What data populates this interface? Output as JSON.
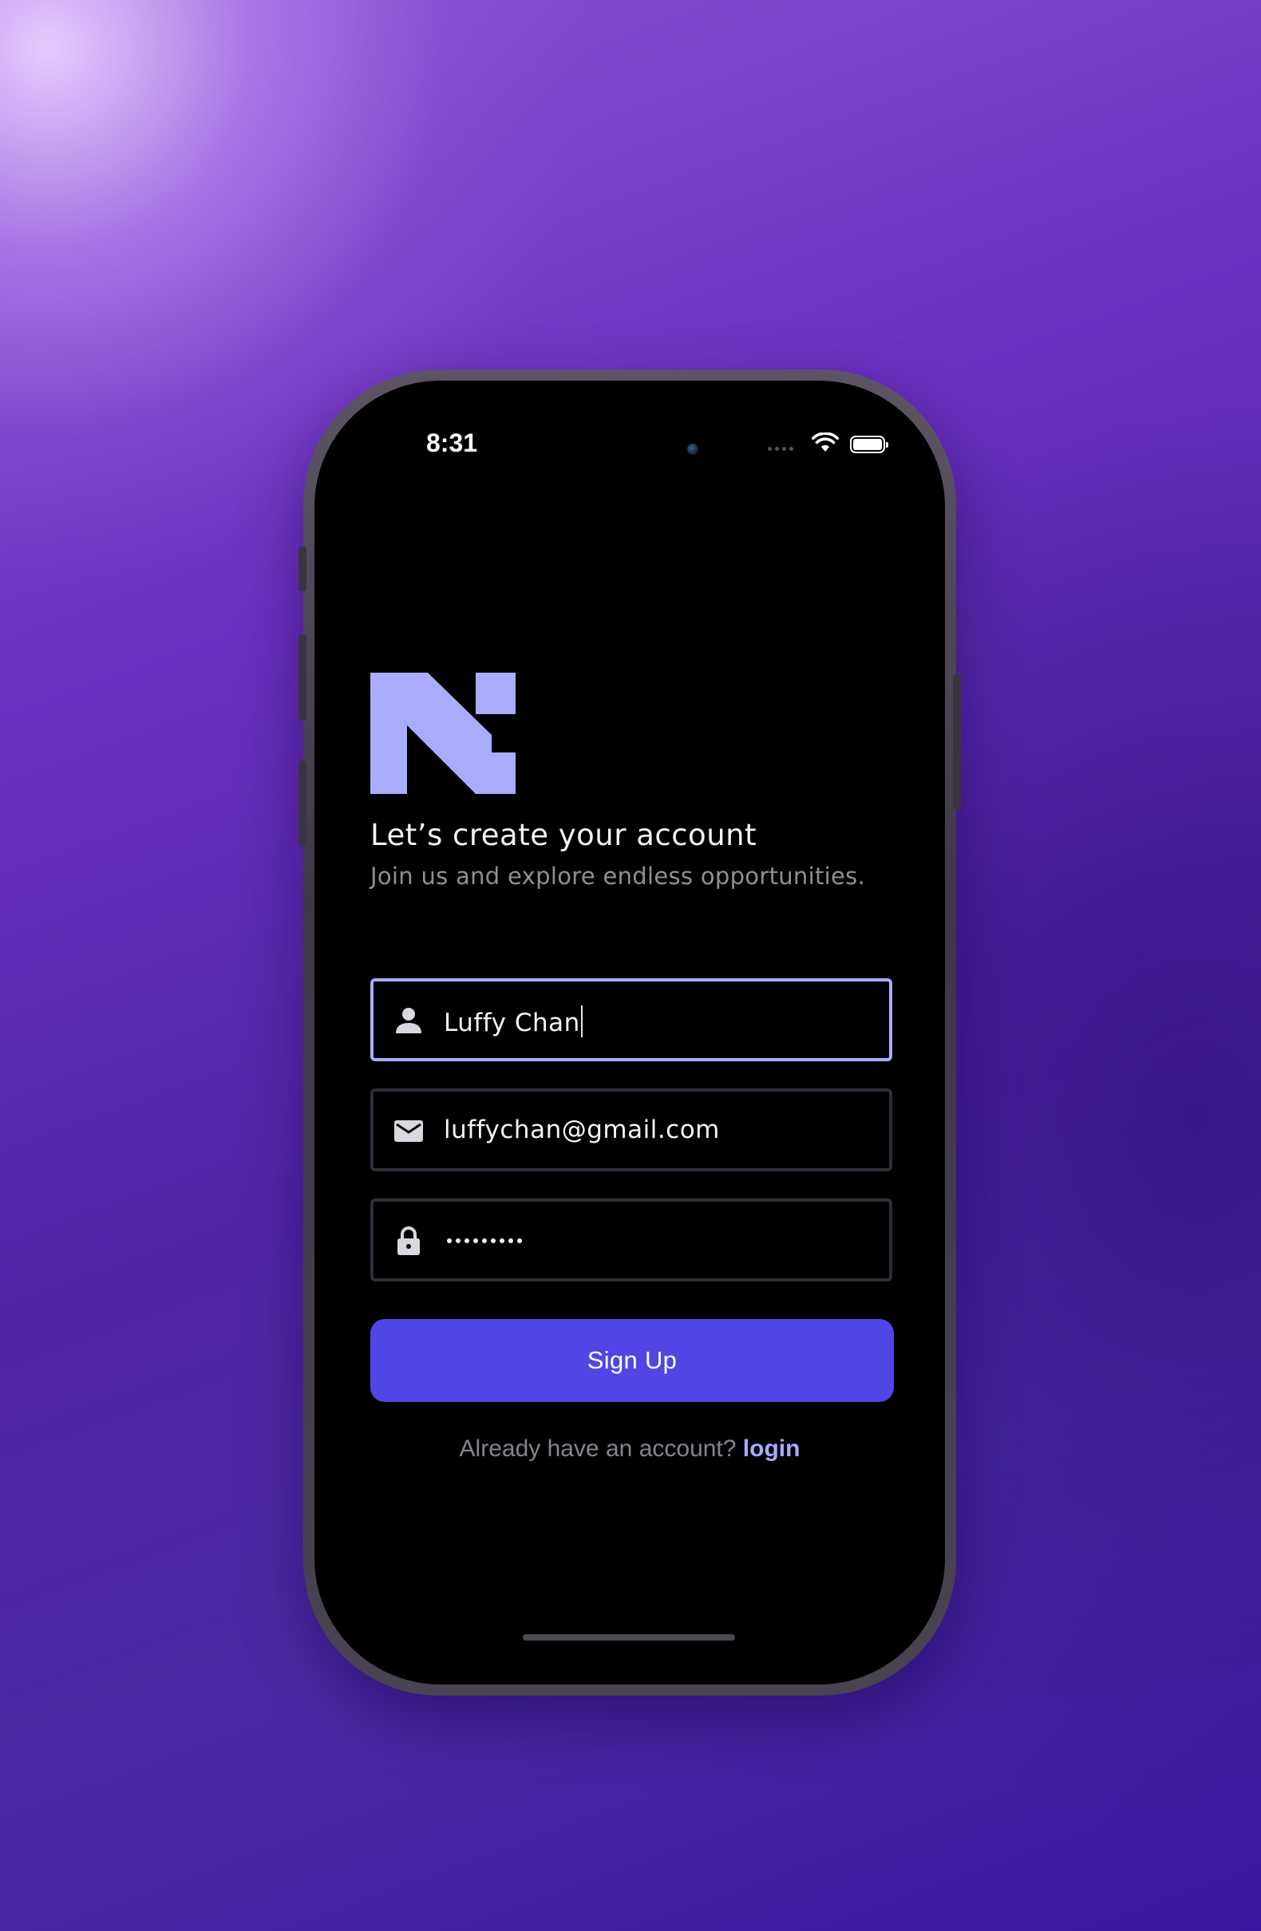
{
  "status_bar": {
    "time": "8:31",
    "wifi_icon": "wifi-icon",
    "battery_icon": "battery-full-icon"
  },
  "logo": {
    "icon": "n-logo-icon",
    "color": "#a9acff"
  },
  "header": {
    "title": "Let’s create your account",
    "subtitle": "Join us and explore endless opportunities."
  },
  "form": {
    "name_field": {
      "icon": "person-icon",
      "value": "Luffy Chan",
      "focused": true
    },
    "email_field": {
      "icon": "mail-icon",
      "value": "luffychan@gmail.com"
    },
    "password_field": {
      "icon": "lock-icon",
      "masked_length": 9
    },
    "submit_label": "Sign Up"
  },
  "footer": {
    "prompt": "Already have an account?",
    "link_label": "login"
  },
  "colors": {
    "accent": "#4f46e5",
    "link": "#a8abff",
    "focus_border": "#a9acff",
    "field_border": "#2f2d3a",
    "background": "#000000"
  }
}
